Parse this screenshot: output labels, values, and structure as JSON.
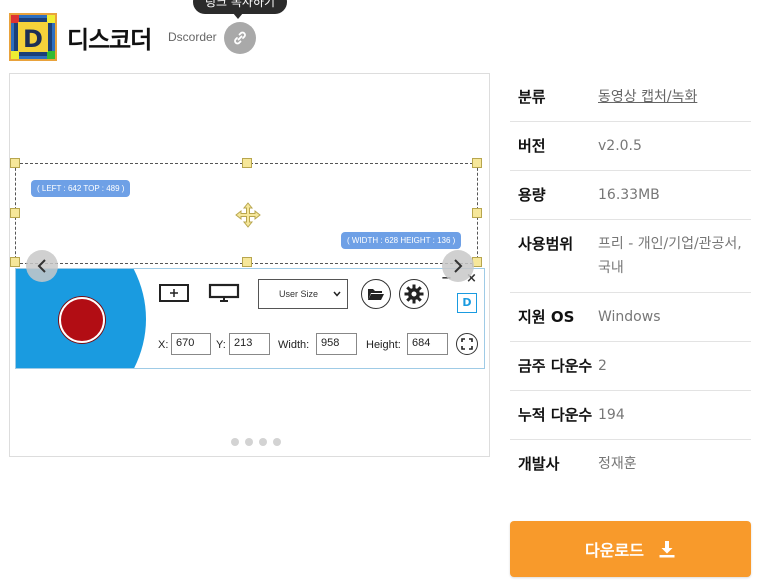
{
  "app": {
    "title": "디스코더",
    "subtitle": "Dscorder",
    "logo_letter": "D",
    "copy_link_tooltip": "링크 복사하기",
    "copy_link_icon": "link-icon"
  },
  "gallery": {
    "slide_count": 4,
    "active_slide": 1,
    "screenshot": {
      "left_top_label": "( LEFT : 642 TOP : 489 )",
      "width_height_label": "( WIDTH : 628 HEIGHT : 136 )",
      "size_select_value": "User Size",
      "fields": [
        {
          "label": "X:",
          "value": "670"
        },
        {
          "label": "Y:",
          "value": "213"
        },
        {
          "label": "Width:",
          "value": "958"
        },
        {
          "label": "Height:",
          "value": "684"
        }
      ],
      "panel_controls": [
        "−",
        "×"
      ]
    }
  },
  "info": {
    "rows": [
      {
        "key": "분류",
        "value": "동영상 캡처/녹화",
        "link": true
      },
      {
        "key": "버전",
        "value": "v2.0.5",
        "link": false
      },
      {
        "key": "용량",
        "value": "16.33MB",
        "link": false
      },
      {
        "key": "사용범위",
        "value": "프리 - 개인/기업/관공서, 국내",
        "link": false
      },
      {
        "key": "지원 OS",
        "value": "Windows",
        "link": false
      },
      {
        "key": "금주 다운수",
        "value": "2",
        "link": false
      },
      {
        "key": "누적 다운수",
        "value": "194",
        "link": false
      },
      {
        "key": "개발사",
        "value": "정재훈",
        "link": false
      }
    ]
  },
  "download": {
    "label": "다운로드",
    "icon": "download-icon"
  },
  "colors": {
    "accent": "#f89a2b",
    "recorder_blue": "#1a9be0",
    "record_red": "#b20d14",
    "label_blue": "#6ea0e6"
  }
}
